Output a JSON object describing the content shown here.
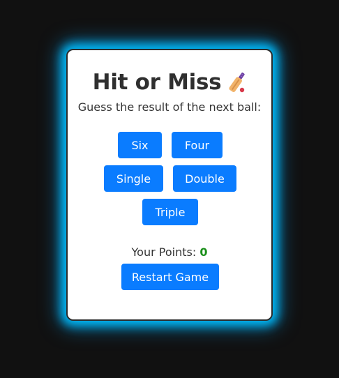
{
  "game": {
    "title": "Hit or Miss",
    "subtitle": "Guess the result of the next ball:",
    "icon": "cricket-bat-icon"
  },
  "choices": {
    "six": "Six",
    "four": "Four",
    "single": "Single",
    "double": "Double",
    "triple": "Triple"
  },
  "score": {
    "label": "Your Points:",
    "value": "0"
  },
  "controls": {
    "restart_label": "Restart Game"
  },
  "colors": {
    "accent": "#0a7cff",
    "glow": "#00bfff",
    "points": "#1a8f1a",
    "background": "#111111"
  }
}
